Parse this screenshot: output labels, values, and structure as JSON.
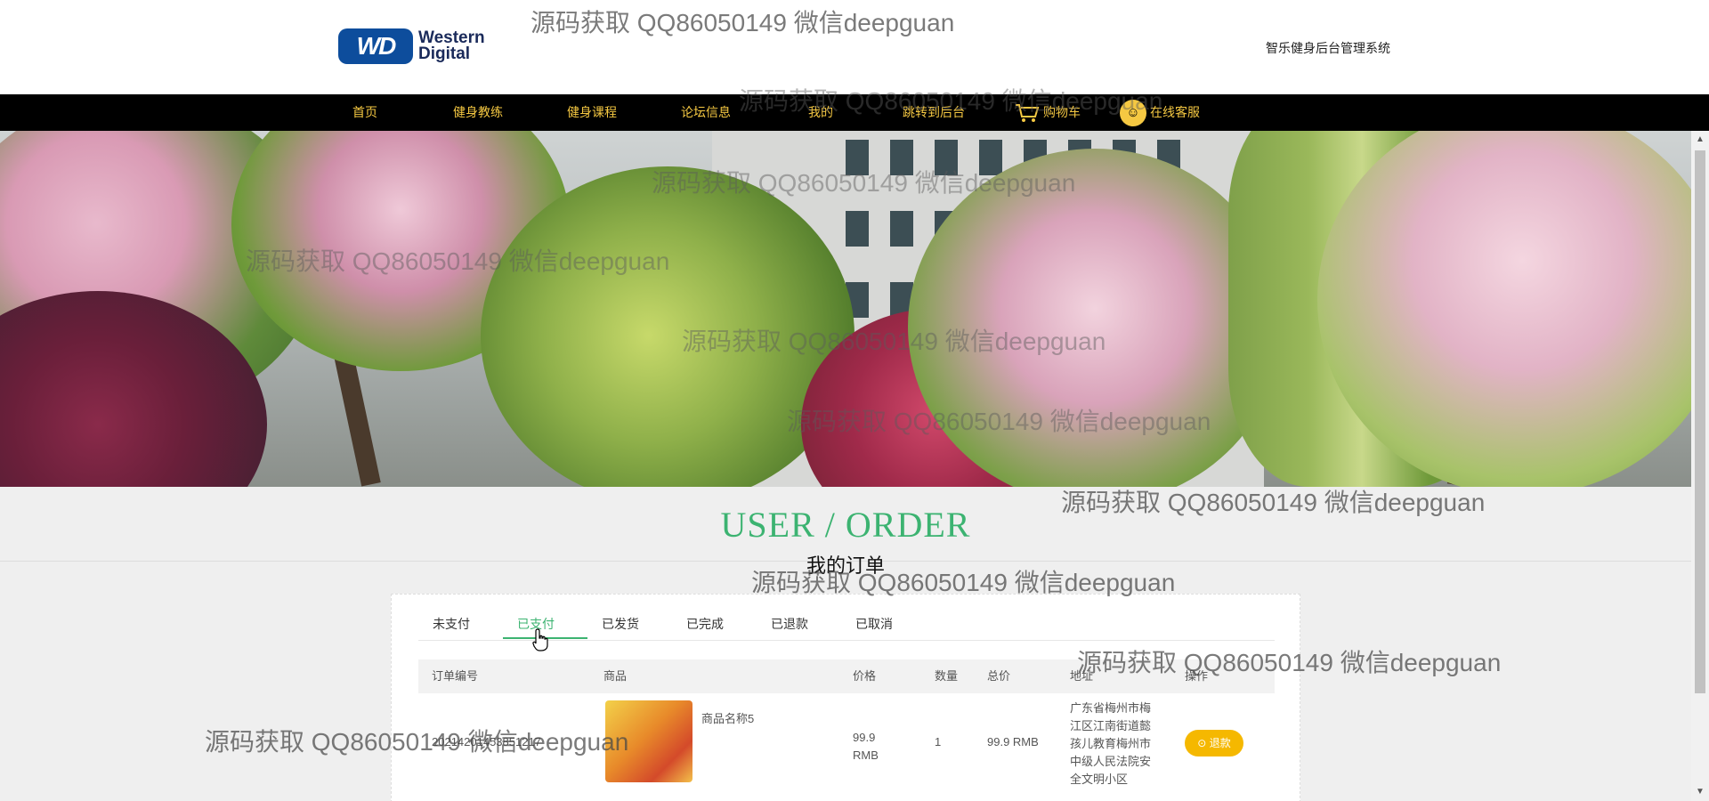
{
  "header": {
    "logo_mark": "WD",
    "logo_line1": "Western",
    "logo_line2": "Digital",
    "system_title": "智乐健身后台管理系统"
  },
  "nav": {
    "items": [
      {
        "label": "首页"
      },
      {
        "label": "健身教练"
      },
      {
        "label": "健身课程"
      },
      {
        "label": "论坛信息"
      },
      {
        "label": "我的"
      },
      {
        "label": "跳转到后台"
      },
      {
        "label": "购物车"
      },
      {
        "label": "在线客服"
      }
    ]
  },
  "section": {
    "title": "USER / ORDER",
    "subtitle": "我的订单"
  },
  "tabs": [
    {
      "label": "未支付"
    },
    {
      "label": "已支付",
      "active": true
    },
    {
      "label": "已发货"
    },
    {
      "label": "已完成"
    },
    {
      "label": "已退款"
    },
    {
      "label": "已取消"
    }
  ],
  "table": {
    "columns": [
      "订单编号",
      "商品",
      "价格",
      "数量",
      "总价",
      "地址",
      "操作"
    ],
    "rows": [
      {
        "order_no": "20214201453851217",
        "product_name": "商品名称5",
        "price": "99.9\nRMB",
        "quantity": "1",
        "total": "99.9 RMB",
        "address": "广东省梅州市梅江区江南街道懿孩儿教育梅州市中级人民法院安全文明小区",
        "action": "退款"
      }
    ]
  },
  "watermark": "源码获取 QQ86050149 微信deepguan",
  "colors": {
    "accent_green": "#3cb371",
    "nav_gold": "#f5c842",
    "refund_yellow": "#f5b800",
    "navbar_bg": "#000000"
  }
}
